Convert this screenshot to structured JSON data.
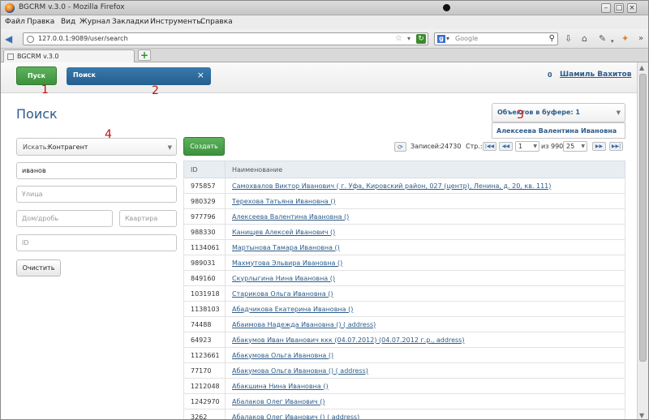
{
  "window": {
    "title": "BGCRM v.3.0 - Mozilla Firefox",
    "menu": [
      "Файл",
      "Правка",
      "Вид",
      "Журнал",
      "Закладки",
      "Инструменты",
      "Справка"
    ]
  },
  "nav": {
    "url": "127.0.0.1:9089/user/search",
    "search_engine": "Google"
  },
  "browser_tab": {
    "label": "BGCRM v.3.0"
  },
  "header": {
    "start_button": "Пуск",
    "search_tab": "Поиск",
    "close_glyph": "×",
    "user_count": "0",
    "user_name": "Шамиль Вахитов"
  },
  "page": {
    "title": "Поиск",
    "buffer_label": "Объектов в буфере: 1",
    "buffer_item": "Алексеева Валентина Ивановна"
  },
  "form": {
    "search_label": "Искать:",
    "search_type": "Контрагент",
    "create_button": "Создать",
    "name_value": "иванов",
    "street_placeholder": "Улица",
    "house_placeholder": "Дом/дробь",
    "flat_placeholder": "Квартира",
    "id_placeholder": "ID",
    "clear_button": "Очистить"
  },
  "pager": {
    "records_label": "Записей:",
    "records_count": "24730",
    "page_label": "Стр.:",
    "current_page": "1",
    "of_label": "из 990",
    "page_size": "25"
  },
  "table": {
    "columns": [
      "ID",
      "Наименование"
    ],
    "rows": [
      {
        "id": "975857",
        "name": "Самохвалов Виктор Иванович ( г. Уфа, Кировский район, 027 (центр), Ленина, д. 20, кв. 111)"
      },
      {
        "id": "980329",
        "name": "Терехова Татьяна Ивановна ()"
      },
      {
        "id": "977796",
        "name": "Алексеева Валентина Ивановна ()"
      },
      {
        "id": "988330",
        "name": "Канищев Алексей Иванович ()"
      },
      {
        "id": "1134061",
        "name": "Мартынова Тамара Ивановна ()"
      },
      {
        "id": "989031",
        "name": "Махмутова Эльвира Ивановна ()"
      },
      {
        "id": "849160",
        "name": "Скурлыгина Нина Ивановна ()"
      },
      {
        "id": "1031918",
        "name": "Старикова Ольга Ивановна ()"
      },
      {
        "id": "1138103",
        "name": "Абадчикова Екатерина Ивановна ()"
      },
      {
        "id": "74488",
        "name": "Абаимова Надежда Ивановна () ( address)"
      },
      {
        "id": "64923",
        "name": "Абакумов Иван Иванович ккк (04.07.2012) (04.07.2012 г.р., address)"
      },
      {
        "id": "1123661",
        "name": "Абакумова Ольга Ивановна ()"
      },
      {
        "id": "77170",
        "name": "Абакумова Ольга Ивановна () ( address)"
      },
      {
        "id": "1212048",
        "name": "Абакшина Нина Ивановна ()"
      },
      {
        "id": "1242970",
        "name": "Абалаков Олег Иванович ()"
      },
      {
        "id": "3262",
        "name": "Абалаков Олег Иванович () ( address)"
      }
    ]
  },
  "markers": [
    "1",
    "2",
    "3",
    "4"
  ]
}
